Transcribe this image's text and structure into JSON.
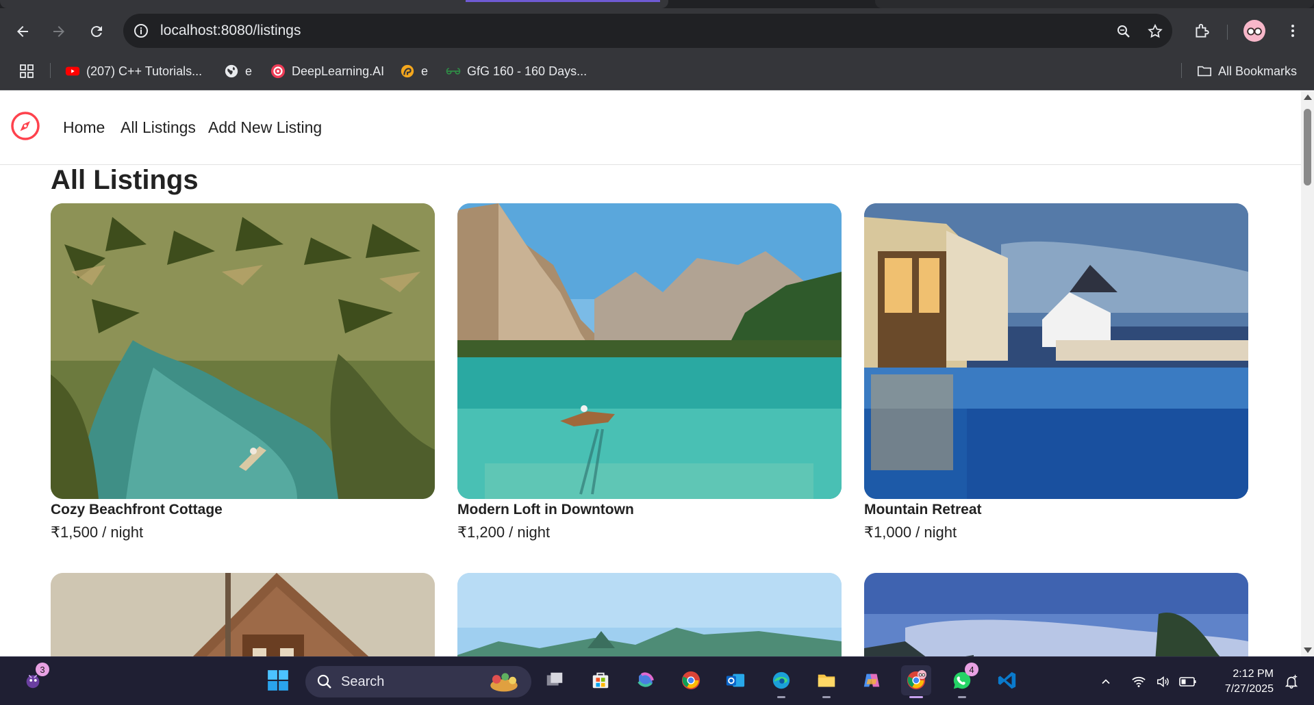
{
  "browser": {
    "url_host": "localhost",
    "url_rest": ":8080/listings",
    "bookmarks": [
      {
        "label": "(207) C++ Tutorials...",
        "icon": "youtube-icon"
      },
      {
        "label": "e",
        "icon": "globe-icon"
      },
      {
        "label": "DeepLearning.AI",
        "icon": "deeplearning-icon"
      },
      {
        "label": "e",
        "icon": "site-icon"
      },
      {
        "label": "GfG 160 - 160 Days...",
        "icon": "gfg-icon"
      }
    ],
    "all_bookmarks": "All Bookmarks"
  },
  "site": {
    "nav": {
      "home": "Home",
      "all_listings": "All Listings",
      "add_new": "Add New Listing"
    },
    "page_title": "All Listings",
    "listings": [
      {
        "title": "Cozy Beachfront Cottage",
        "price": "₹1,500 / night",
        "image": "tropical-lagoon"
      },
      {
        "title": "Modern Loft in Downtown",
        "price": "₹1,200 / night",
        "image": "mountain-lake"
      },
      {
        "title": "Mountain Retreat",
        "price": "₹1,000 / night",
        "image": "resort-pool"
      },
      {
        "image": "wooden-cabin"
      },
      {
        "image": "island-bay"
      },
      {
        "image": "tropical-sunset"
      }
    ]
  },
  "taskbar": {
    "search_label": "Search",
    "widgets_badge": "3",
    "whatsapp_badge": "4",
    "time": "2:12 PM",
    "date": "7/27/2025"
  },
  "colors": {
    "brand": "#fe424d",
    "chrome_bg": "#35363a",
    "taskbar_bg": "#1f1f33"
  }
}
